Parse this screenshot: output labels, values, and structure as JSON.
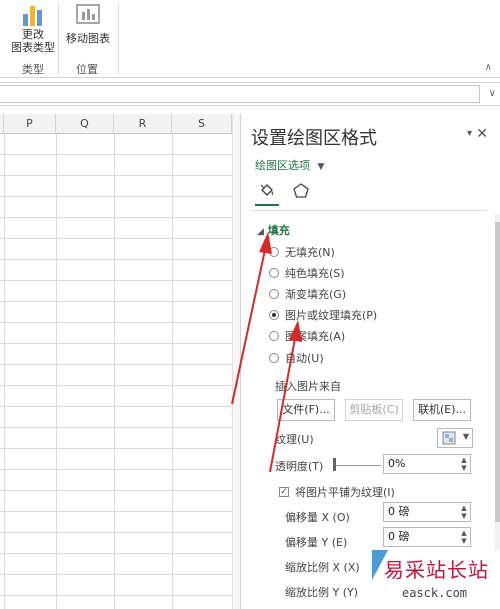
{
  "ribbon": {
    "change_chart_type_line1": "更改",
    "change_chart_type_line2": "图表类型",
    "move_chart": "移动图表",
    "group_type": "类型",
    "group_location": "位置"
  },
  "columns": [
    "P",
    "Q",
    "R",
    "S"
  ],
  "pane": {
    "title": "设置绘图区格式",
    "options_label": "绘图区选项",
    "section_fill": "填充",
    "fill_options": [
      {
        "label": "无填充(N)",
        "checked": false
      },
      {
        "label": "纯色填充(S)",
        "checked": false
      },
      {
        "label": "渐变填充(G)",
        "checked": false
      },
      {
        "label": "图片或纹理填充(P)",
        "checked": true
      },
      {
        "label": "图案填充(A)",
        "checked": false
      },
      {
        "label": "自动(U)",
        "checked": false
      }
    ],
    "insert_from": "插入图片来自",
    "file_button": "文件(F)...",
    "clipboard_button": "剪贴板(C)",
    "online_button": "联机(E)...",
    "texture_label": "纹理(U)",
    "transparency_label": "透明度(T)",
    "transparency_value": "0%",
    "tile_checkbox_label": "将图片平铺为纹理(I)",
    "tile_checked": true,
    "offset_x_label": "偏移量 X (O)",
    "offset_x_value": "0 磅",
    "offset_y_label": "偏移量 Y (E)",
    "offset_y_value": "0 磅",
    "scale_x_label": "缩放比例 X (X)",
    "scale_y_label": "缩放比例 Y (Y)"
  },
  "watermark": {
    "title": "易采站长站",
    "url": "easck.com"
  },
  "colors": {
    "accent": "#217346",
    "arrow": "#d62a2a"
  },
  "icons": {
    "fill_tab": "paint-bucket-icon",
    "effects_tab": "pentagon-icon",
    "close": "close-icon"
  }
}
